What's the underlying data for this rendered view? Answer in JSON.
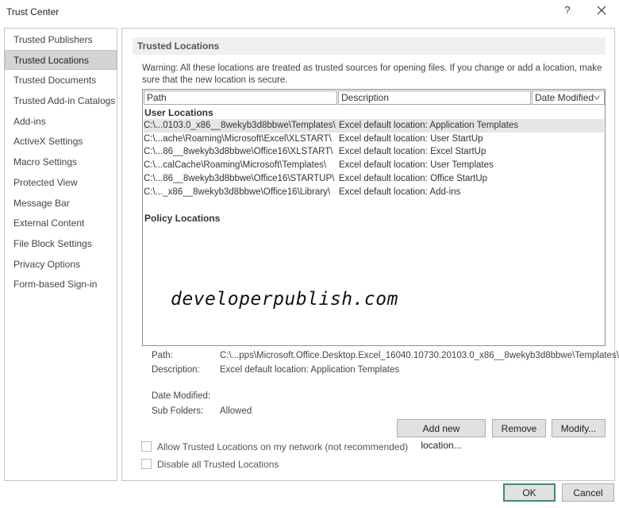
{
  "window": {
    "title": "Trust Center",
    "help_label": "?",
    "close_icon": "close-icon"
  },
  "sidebar": {
    "items": [
      {
        "label": "Trusted Publishers",
        "selected": false
      },
      {
        "label": "Trusted Locations",
        "selected": true
      },
      {
        "label": "Trusted Documents",
        "selected": false
      },
      {
        "label": "Trusted Add-in Catalogs",
        "selected": false
      },
      {
        "label": "Add-ins",
        "selected": false
      },
      {
        "label": "ActiveX Settings",
        "selected": false
      },
      {
        "label": "Macro Settings",
        "selected": false
      },
      {
        "label": "Protected View",
        "selected": false
      },
      {
        "label": "Message Bar",
        "selected": false
      },
      {
        "label": "External Content",
        "selected": false
      },
      {
        "label": "File Block Settings",
        "selected": false
      },
      {
        "label": "Privacy Options",
        "selected": false
      },
      {
        "label": "Form-based Sign-in",
        "selected": false
      }
    ]
  },
  "main": {
    "header": "Trusted Locations",
    "warning": "Warning: All these locations are treated as trusted sources for opening files.  If you change or add a location, make sure that the new location is secure.",
    "columns": {
      "path": "Path",
      "description": "Description",
      "date_modified": "Date Modified"
    },
    "user_locations_label": "User Locations",
    "policy_locations_label": "Policy Locations",
    "rows": [
      {
        "path": "C:\\...0103.0_x86__8wekyb3d8bbwe\\Templates\\",
        "description": "Excel default location: Application Templates",
        "selected": true
      },
      {
        "path": "C:\\...ache\\Roaming\\Microsoft\\Excel\\XLSTART\\",
        "description": "Excel default location: User StartUp",
        "selected": false
      },
      {
        "path": "C:\\...86__8wekyb3d8bbwe\\Office16\\XLSTART\\",
        "description": "Excel default location: Excel StartUp",
        "selected": false
      },
      {
        "path": "C:\\...calCache\\Roaming\\Microsoft\\Templates\\",
        "description": "Excel default location: User Templates",
        "selected": false
      },
      {
        "path": "C:\\...86__8wekyb3d8bbwe\\Office16\\STARTUP\\",
        "description": "Excel default location: Office StartUp",
        "selected": false
      },
      {
        "path": "C:\\..._x86__8wekyb3d8bbwe\\Office16\\Library\\",
        "description": "Excel default location: Add-ins",
        "selected": false
      }
    ],
    "details": {
      "path_label": "Path:",
      "path_value": "C:\\...pps\\Microsoft.Office.Desktop.Excel_16040.10730.20103.0_x86__8wekyb3d8bbwe\\Templates\\",
      "description_label": "Description:",
      "description_value": "Excel default location: Application Templates",
      "date_modified_label": "Date Modified:",
      "date_modified_value": "",
      "sub_folders_label": "Sub Folders:",
      "sub_folders_value": "Allowed"
    },
    "buttons": {
      "add": "Add new location...",
      "remove": "Remove",
      "modify": "Modify..."
    },
    "checkboxes": [
      {
        "label": "Allow Trusted Locations on my network (not recommended)",
        "checked": false
      },
      {
        "label": "Disable all Trusted Locations",
        "checked": false
      }
    ],
    "watermark": "developerpublish.com"
  },
  "footer": {
    "ok": "OK",
    "cancel": "Cancel"
  },
  "colors": {
    "selected_row": "#e6e6e6",
    "selected_sidebar": "#d4d4d4",
    "default_button_border": "#3c8f6f"
  }
}
